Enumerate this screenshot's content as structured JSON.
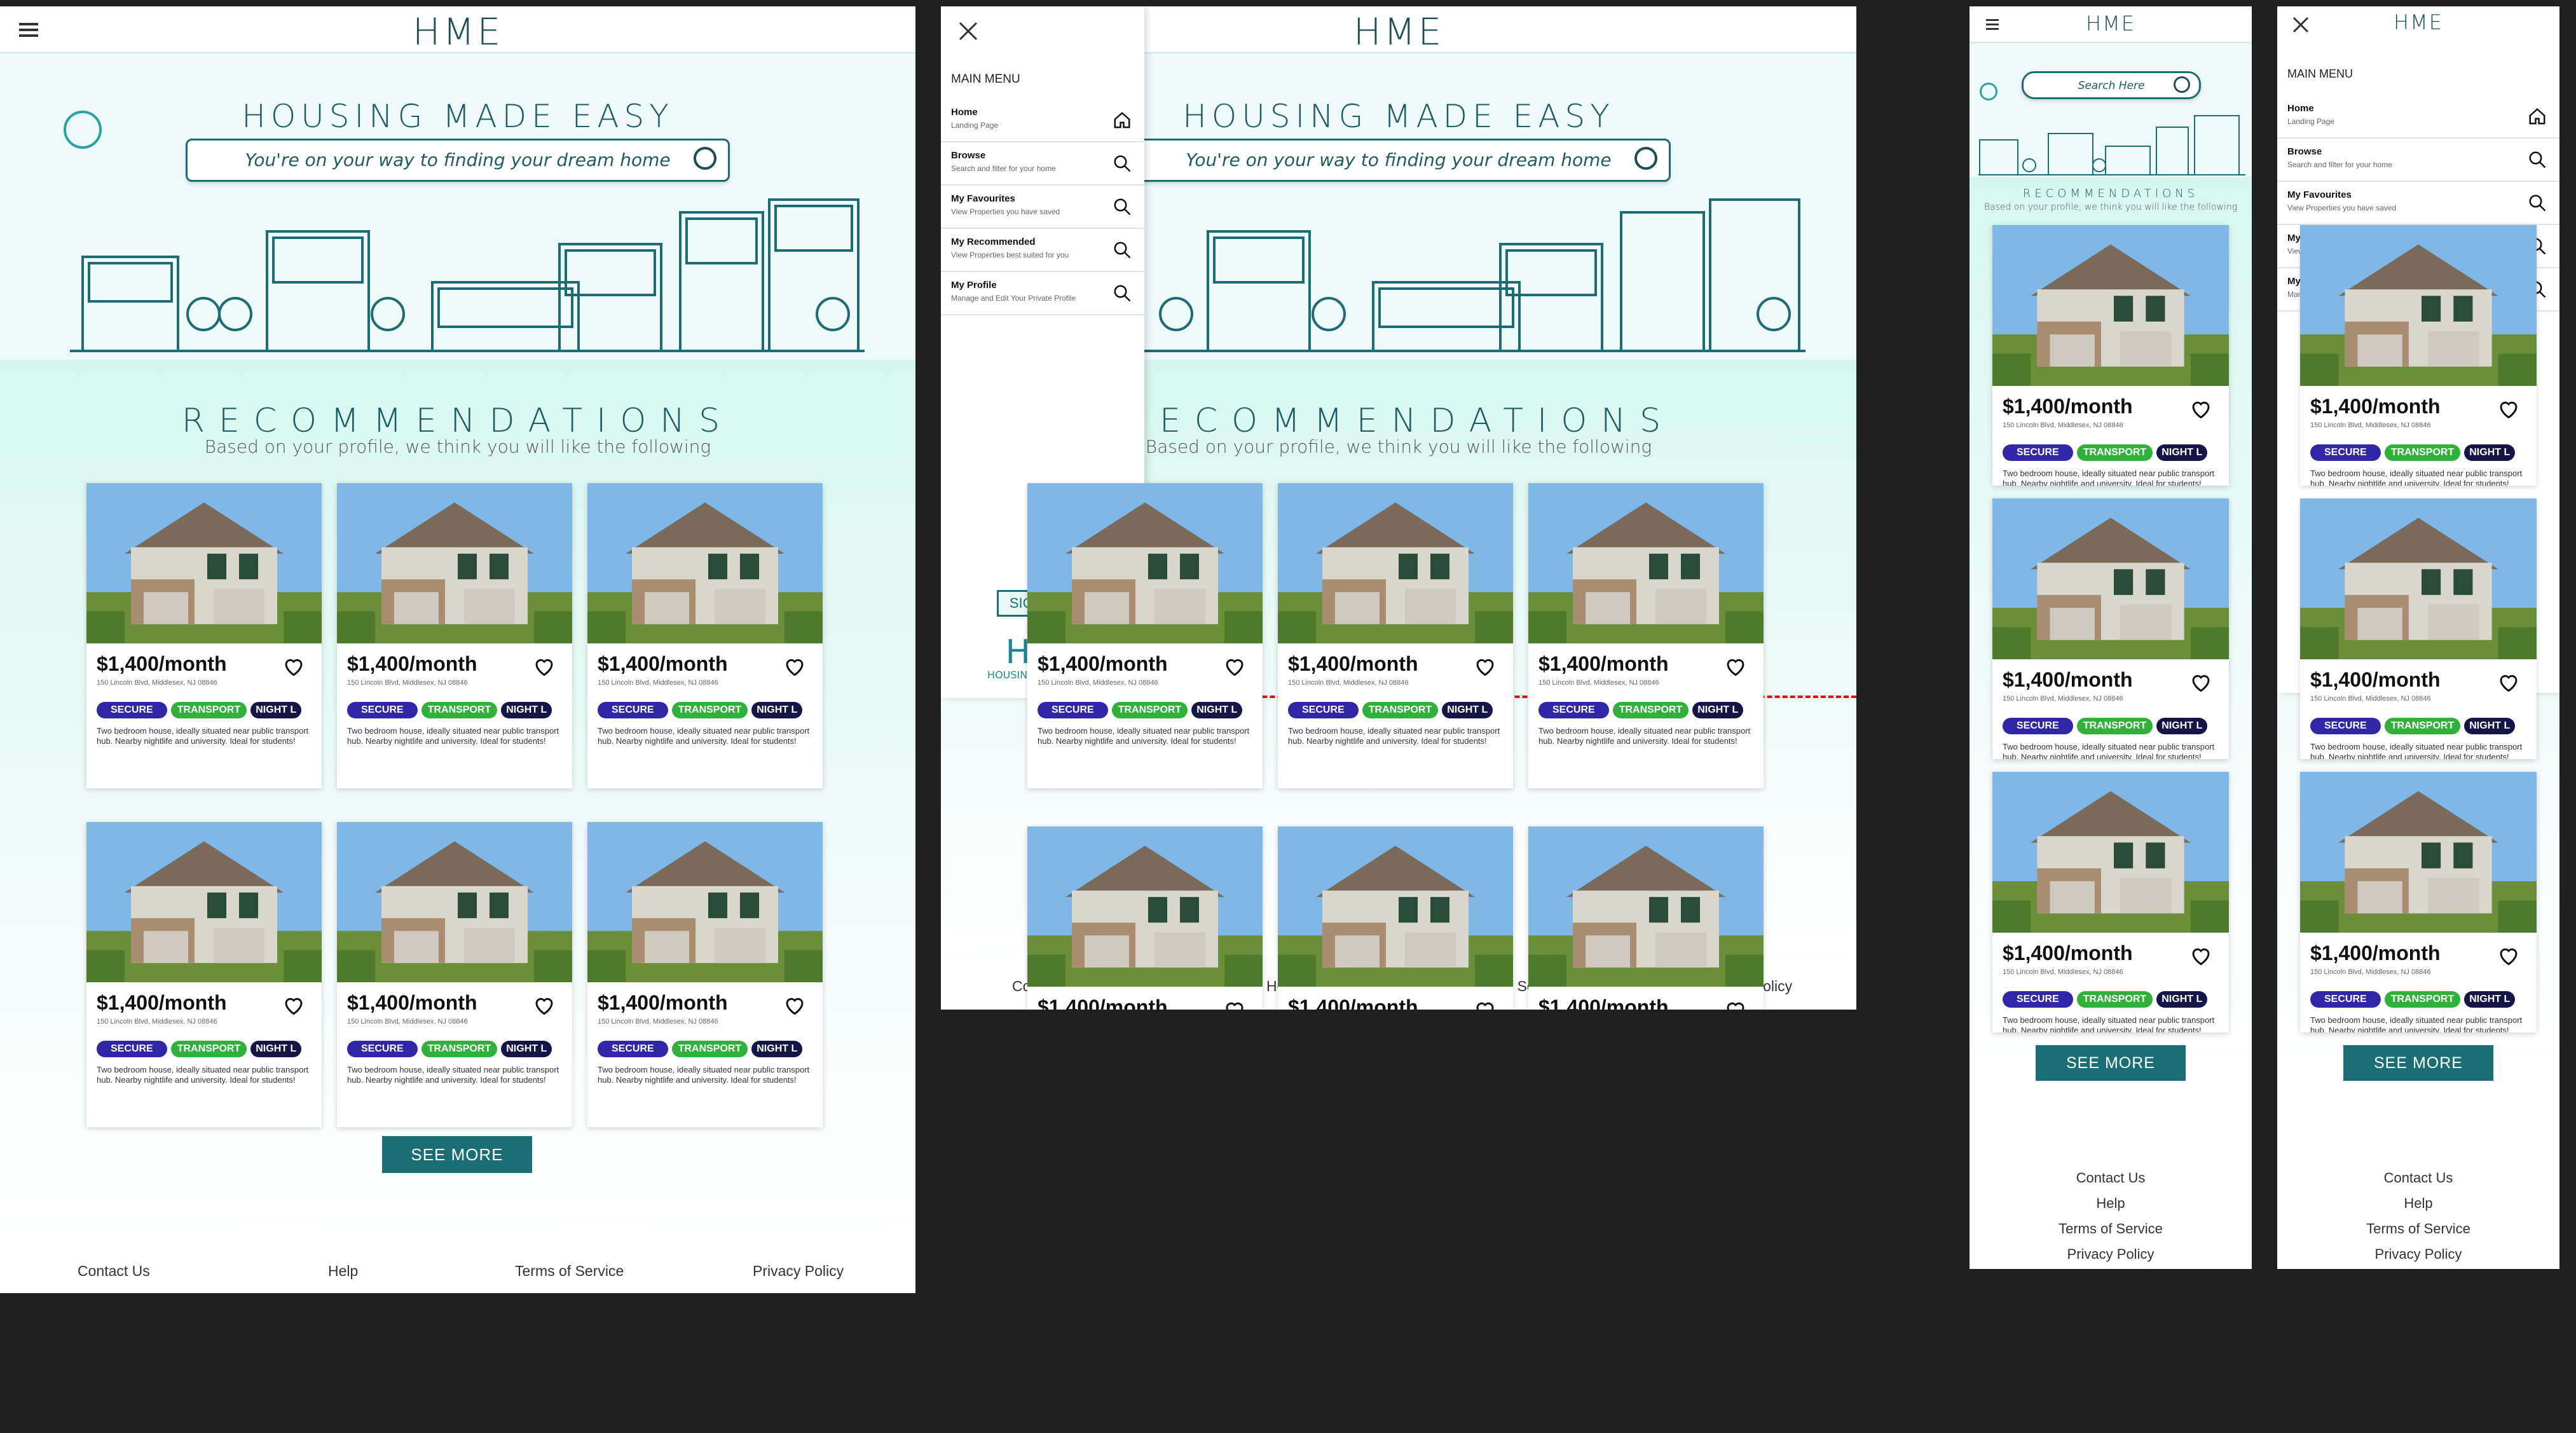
{
  "brand": {
    "logo": "HME",
    "tagline": "HOUSING MADE EASY",
    "logo_sub": "HOUSING MADE EASY"
  },
  "search": {
    "placeholder": "You're on your way to finding your dream home",
    "mobile_placeholder": "Search Here"
  },
  "recommendations": {
    "title": "RECOMMENDATIONS",
    "subtitle": "Based on your profile, we think you will like the following"
  },
  "listing": {
    "price": "$1,400/month",
    "address": "150 Lincoln Blvd, Middlesex, NJ 08846",
    "tags": [
      "SECURE",
      "TRANSPORT",
      "NIGHT L"
    ],
    "description": "Two bedroom house, ideally situated near public transport hub. Nearby nightlife and university. Ideal for students!"
  },
  "see_more": "SEE MORE",
  "footer": [
    "Contact Us",
    "Help",
    "Terms of Service",
    "Privacy Policy"
  ],
  "menu": {
    "title": "MAIN MENU",
    "items": [
      {
        "label": "Home",
        "sub": "Landing Page",
        "icon": "home-icon"
      },
      {
        "label": "Browse",
        "sub": "Search and filter for your home",
        "icon": "search-icon"
      },
      {
        "label": "My Favourites",
        "sub": "View Properties you have saved",
        "icon": "search-icon"
      },
      {
        "label": "My Recommended",
        "sub": "View Properties best suited for you",
        "icon": "search-icon"
      },
      {
        "label": "My Profile",
        "sub": "Manage and Edit Your Private Profile",
        "icon": "search-icon"
      }
    ],
    "sign_out": "SIGN OUT"
  },
  "colors": {
    "teal": "#1a6e76",
    "secure": "#3126a8",
    "transport": "#2fb13a",
    "night": "#151548",
    "mint": "#d6f7ef"
  }
}
